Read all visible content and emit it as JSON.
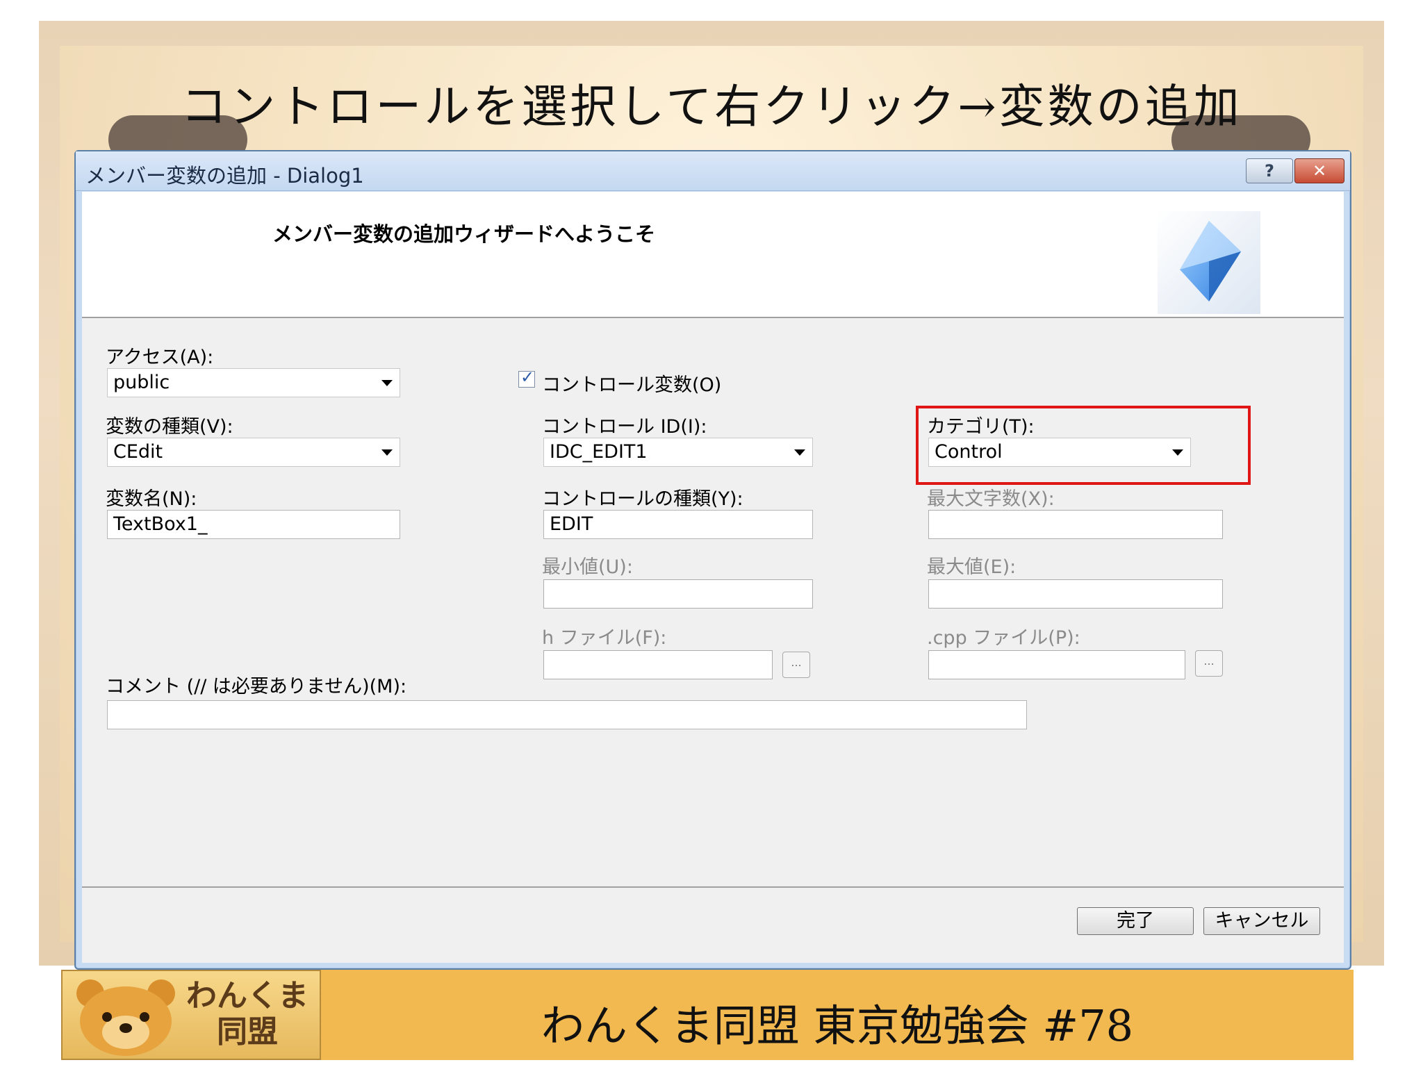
{
  "slide": {
    "title": "コントロールを選択して右クリック→変数の追加"
  },
  "dialog": {
    "title": "メンバー変数の追加 - Dialog1",
    "help_button": "?",
    "close_button": "✕",
    "header_title": "メンバー変数の追加ウィザードへようこそ",
    "access": {
      "label": "アクセス(A):",
      "value": "public"
    },
    "var_type": {
      "label": "変数の種類(V):",
      "value": "CEdit"
    },
    "var_name": {
      "label": "変数名(N):",
      "value": "TextBox1_"
    },
    "control_var": {
      "label": "コントロール変数(O)",
      "checked": true
    },
    "control_id": {
      "label": "コントロール ID(I):",
      "value": "IDC_EDIT1"
    },
    "control_type": {
      "label": "コントロールの種類(Y):",
      "value": "EDIT"
    },
    "min_value": {
      "label": "最小値(U):",
      "value": ""
    },
    "h_file": {
      "label": "h ファイル(F):",
      "value": "",
      "browse": "..."
    },
    "category": {
      "label": "カテゴリ(T):",
      "value": "Control"
    },
    "max_chars": {
      "label": "最大文字数(X):",
      "value": ""
    },
    "max_value": {
      "label": "最大値(E):",
      "value": ""
    },
    "cpp_file": {
      "label": ".cpp ファイル(P):",
      "value": "",
      "browse": "..."
    },
    "comment": {
      "label": "コメント (// は必要ありません)(M):",
      "value": ""
    },
    "finish_button": "完了",
    "cancel_button": "キャンセル",
    "highlight_color": "#e01616"
  },
  "banner": {
    "logo_text": "わんくま\n同盟",
    "text": "わんくま同盟 東京勉強会 #78"
  }
}
